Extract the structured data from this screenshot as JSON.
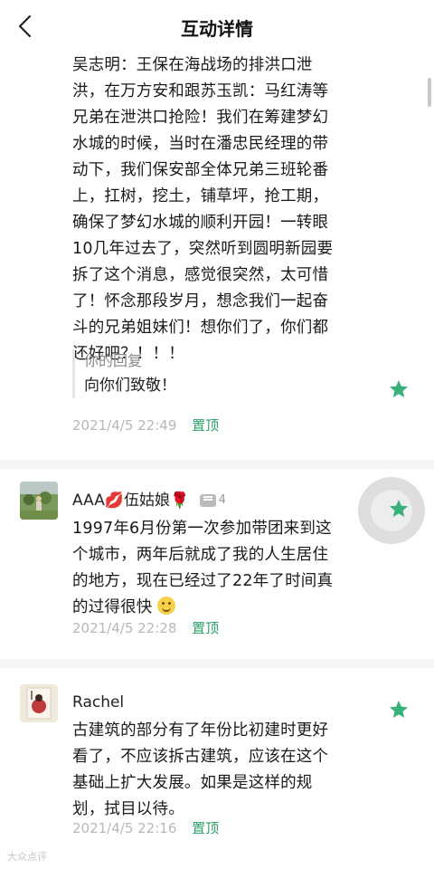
{
  "header": {
    "title": "互动详情"
  },
  "comments": [
    {
      "body_lines": [
        "吴志明：王保在海战场的排洪口泄",
        "洪，在万方安和跟苏玉凯：马红涛等",
        "兄弟在泄洪口抢险！我们在筹建梦幻",
        "水城的时候，当时在潘忠民经理的带",
        "动下，我们保安部全体兄弟三班轮番",
        "上，扛树，挖土，铺草坪，抢工期，",
        "确保了梦幻水城的顺利开园！一转眼",
        "10几年过去了，突然听到圆明新园要",
        "拆了这个消息，感觉很突然，太可惜",
        "了！怀念那段岁月，想念我们一起奋",
        "斗的兄弟姐妹们！想你们了，你们都",
        "还好吧？！！！"
      ],
      "reply_label": "你的回复",
      "reply_text": "向你们致敬！",
      "time": "2021/4/5 22:49",
      "pin_label": "置顶"
    },
    {
      "username": "AAA💋伍姑娘🌹",
      "badge_count": "4",
      "body_lines": [
        "1997年6月份第一次参加带团来到这",
        "个城市，两年后就成了我的人生居住",
        "的地方，现在已经过了22年了时间真",
        "的过得很快"
      ],
      "time": "2021/4/5 22:28",
      "pin_label": "置顶"
    },
    {
      "username": "Rachel",
      "body_lines": [
        "古建筑的部分有了年份比初建时更好",
        "看了，不应该拆古建筑，应该在这个",
        "基础上扩大发展。如果是这样的规",
        "划，拭目以待。"
      ],
      "time": "2021/4/5 22:16",
      "pin_label": "置顶"
    }
  ],
  "watermark": "大众点评",
  "colors": {
    "accent_green": "#2e9f6a",
    "star_green": "#3ab07a",
    "meta_gray": "#b8b8b8"
  },
  "icons": {
    "back": "chevron-left-icon",
    "star": "star-icon",
    "comment_badge": "comment-icon"
  }
}
